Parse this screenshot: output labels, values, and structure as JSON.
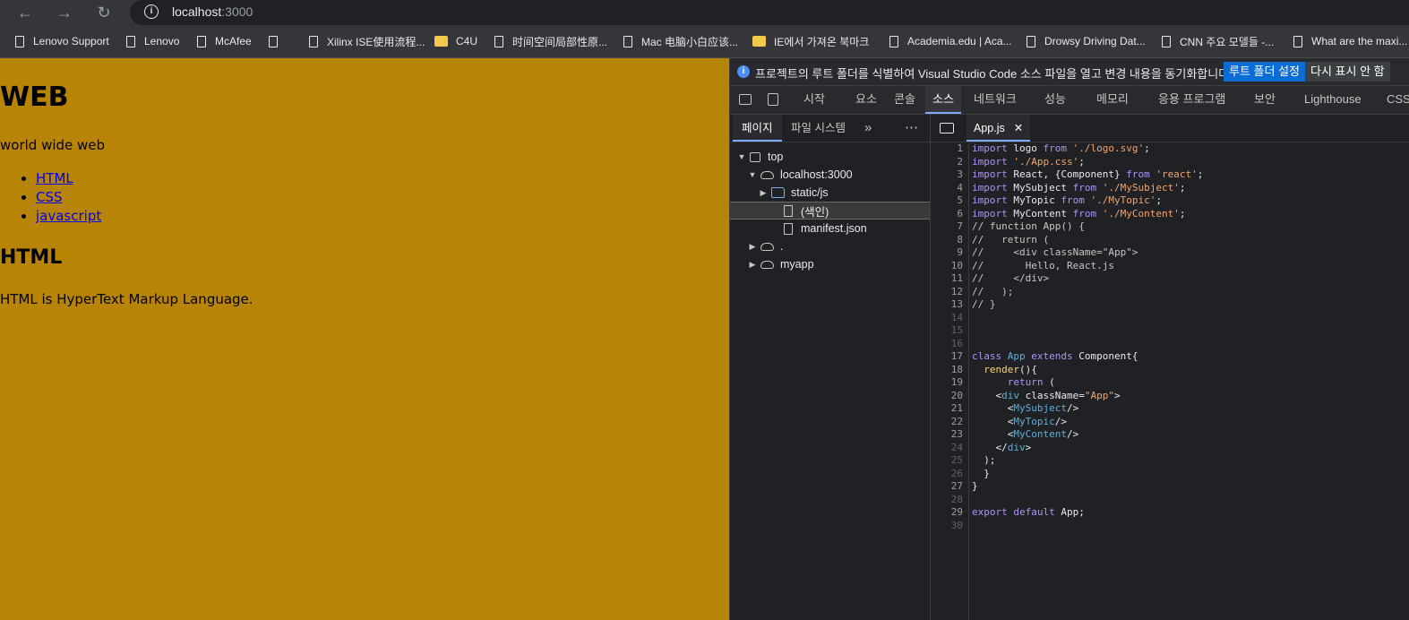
{
  "browser": {
    "url_host": "localhost",
    "url_port": ":3000",
    "bookmarks": [
      "Lenovo Support",
      "Lenovo",
      "McAfee",
      "",
      "Xilinx ISE使用流程...",
      "C4U",
      "时间空间局部性原...",
      "Mac 电脑小白应该...",
      "IE에서 가져온 북마크",
      "Academia.edu | Aca...",
      "Drowsy Driving Dat...",
      "CNN 주요 모델들 -...",
      "What are the maxi..."
    ]
  },
  "page": {
    "title": "WEB",
    "subtitle": "world wide web",
    "links": [
      "HTML",
      "CSS",
      "javascript"
    ],
    "section_title": "HTML",
    "section_text": "HTML is HyperText Markup Language."
  },
  "devtools": {
    "infobar_message": "프로젝트의 루트 폴더를 식별하여 Visual Studio Code 소스 파일을 열고 변경 내용을 동기화합니다.",
    "infobar_btn_primary": "루트 폴더 설정",
    "infobar_btn_secondary": "다시 표시 안 함",
    "tabs": [
      "시작",
      "요소",
      "콘솔",
      "소스",
      "네트워크",
      "성능",
      "메모리",
      "응용 프로그램",
      "보안",
      "Lighthouse",
      "CSS"
    ],
    "nav_tabs": [
      "페이지",
      "파일 시스템"
    ],
    "tree": [
      "top",
      "localhost:3000",
      "static/js",
      "(색인)",
      "manifest.json",
      ".",
      "myapp"
    ],
    "editor_tab": "App.js",
    "line_numbers": [
      "1",
      "2",
      "3",
      "4",
      "5",
      "6",
      "7",
      "8",
      "9",
      "10",
      "11",
      "12",
      "13",
      "14",
      "15",
      "16",
      "17",
      "18",
      "19",
      "20",
      "21",
      "22",
      "23",
      "24",
      "25",
      "26",
      "27",
      "28",
      "29",
      "30"
    ]
  }
}
